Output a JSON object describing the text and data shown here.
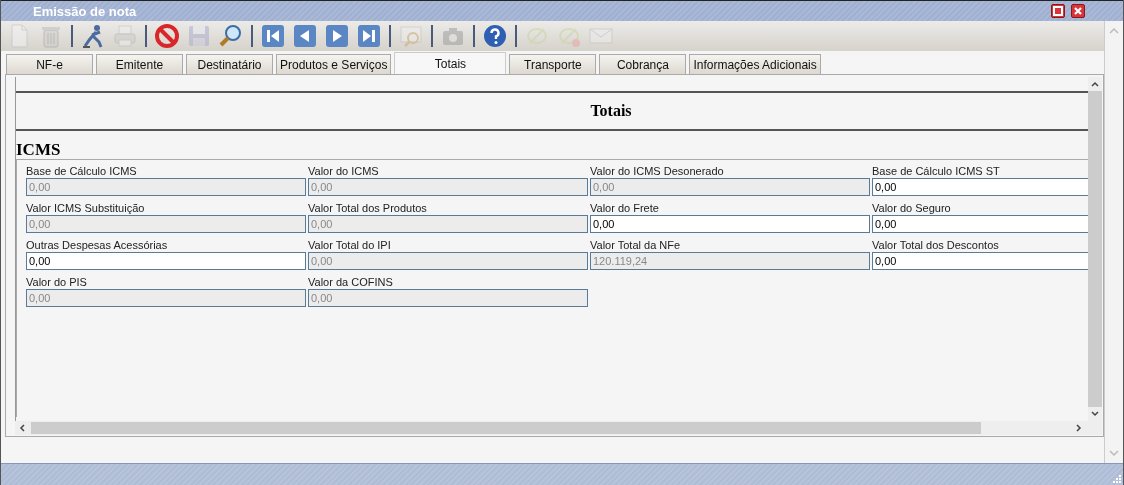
{
  "window": {
    "title": "Emissão de nota"
  },
  "toolbar": [
    [
      {
        "kind": "new",
        "disabled": true
      },
      {
        "kind": "delete",
        "disabled": true
      }
    ],
    [
      {
        "kind": "run",
        "disabled": false
      },
      {
        "kind": "print",
        "disabled": true
      }
    ],
    [
      {
        "kind": "cancel",
        "disabled": false
      },
      {
        "kind": "save",
        "disabled": true
      },
      {
        "kind": "search",
        "disabled": false
      }
    ],
    [
      {
        "kind": "first",
        "disabled": false
      },
      {
        "kind": "prev",
        "disabled": false
      },
      {
        "kind": "next",
        "disabled": false
      },
      {
        "kind": "last",
        "disabled": false
      }
    ],
    [
      {
        "kind": "preview",
        "disabled": true
      }
    ],
    [
      {
        "kind": "camera",
        "disabled": true
      }
    ],
    [
      {
        "kind": "help",
        "disabled": false
      }
    ],
    [
      {
        "kind": "sign",
        "disabled": true
      },
      {
        "kind": "sign-error",
        "disabled": true
      },
      {
        "kind": "mail",
        "disabled": true
      }
    ]
  ],
  "tabs": [
    {
      "label": "NF-e",
      "selected": false
    },
    {
      "label": "Emitente",
      "selected": false
    },
    {
      "label": "Destinatário",
      "selected": false
    },
    {
      "label": "Produtos e Serviços",
      "selected": false
    },
    {
      "label": "Totais",
      "selected": true
    },
    {
      "label": "Transporte",
      "selected": false
    },
    {
      "label": "Cobrança",
      "selected": false
    },
    {
      "label": "Informações Adicionais",
      "selected": false
    }
  ],
  "page_title": "Totais",
  "section": "ICMS",
  "fields": [
    {
      "label": "Base de Cálculo ICMS",
      "value": "0,00",
      "disabled": true
    },
    {
      "label": "Valor do ICMS",
      "value": "0,00",
      "disabled": true
    },
    {
      "label": "Valor do ICMS Desonerado",
      "value": "0,00",
      "disabled": true
    },
    {
      "label": "Base de Cálculo ICMS ST",
      "value": "0,00",
      "disabled": false
    },
    {
      "label": "Valor ICMS Substituição",
      "value": "0,00",
      "disabled": true
    },
    {
      "label": "Valor Total dos Produtos",
      "value": "0,00",
      "disabled": true
    },
    {
      "label": "Valor do Frete",
      "value": "0,00",
      "disabled": false
    },
    {
      "label": "Valor do Seguro",
      "value": "0,00",
      "disabled": false
    },
    {
      "label": "Outras Despesas Acessórias",
      "value": "0,00",
      "disabled": false
    },
    {
      "label": "Valor Total do IPI",
      "value": "0,00",
      "disabled": true
    },
    {
      "label": "Valor Total da NFe",
      "value": "120.119,24",
      "disabled": true
    },
    {
      "label": "Valor Total dos Descontos",
      "value": "0,00",
      "disabled": false
    },
    {
      "label": "Valor do PIS",
      "value": "0,00",
      "disabled": true
    },
    {
      "label": "Valor da COFINS",
      "value": "0,00",
      "disabled": true
    }
  ]
}
